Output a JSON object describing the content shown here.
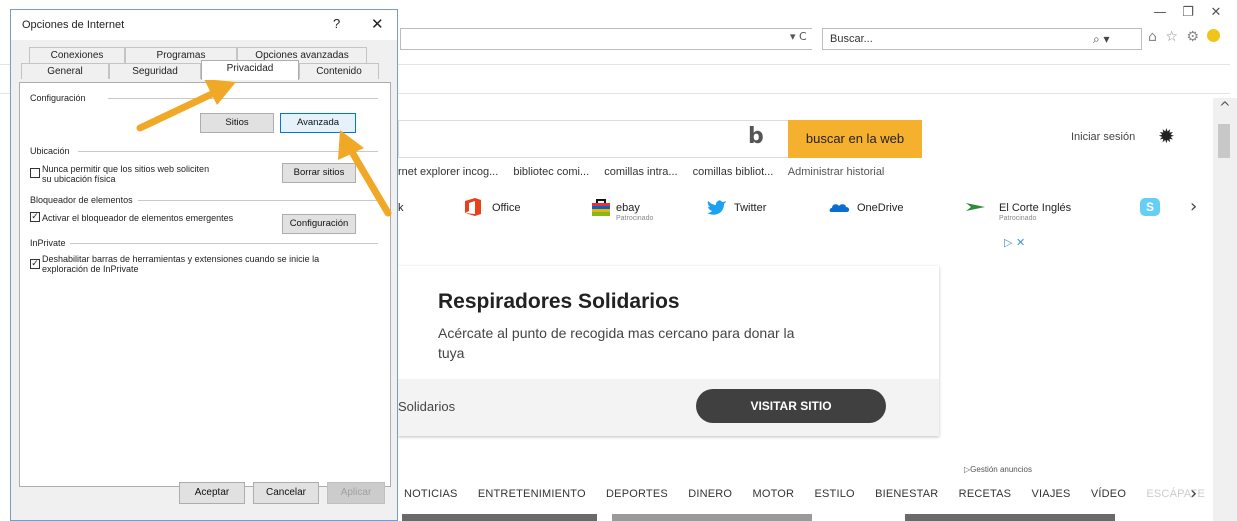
{
  "browser": {
    "window_buttons": {
      "minimize": "—",
      "restore": "❐",
      "close": "✕"
    },
    "address_controls": "▾ C",
    "search_placeholder": "Buscar...",
    "search_icon_glyph": "⌕ ▾",
    "toolbar_icons": "⌂ ☆ ⚙"
  },
  "page": {
    "bing_button": "buscar en la web",
    "signin": "Iniciar sesión",
    "history_items": [
      "rnet explorer incog...",
      "bibliotec comi...",
      "comillas intra...",
      "comillas bibliot...",
      "Administrar historial"
    ],
    "quick_links": [
      {
        "label": "k"
      },
      {
        "label": "Office",
        "color": "#e8401c"
      },
      {
        "label": "ebay",
        "sub": "Patrocinado"
      },
      {
        "label": "Twitter",
        "color": "#1da1f2"
      },
      {
        "label": "OneDrive",
        "color": "#0a6ed1"
      },
      {
        "label": "El Corte Inglés",
        "sub": "Patrocinado",
        "color": "#2e8b3a"
      },
      {
        "label": "S",
        "color": "#00aff0"
      }
    ],
    "ad_markers": "▷ ✕",
    "ad": {
      "title": "Respiradores Solidarios",
      "text": "Acércate al punto de recogida mas cercano para donar la tuya",
      "sponsor": "Solidarios",
      "button": "VISITAR SITIO"
    },
    "gestion": "▷Gestión anuncios",
    "nav_items": [
      "NOTICIAS",
      "ENTRETENIMIENTO",
      "DEPORTES",
      "DINERO",
      "MOTOR",
      "ESTILO",
      "BIENESTAR",
      "RECETAS",
      "VIAJES",
      "VÍDEO"
    ],
    "nav_faded": "ESCÁPATE"
  },
  "dialog": {
    "title": "Opciones de Internet",
    "help": "?",
    "close": "✕",
    "tabs_back": [
      "Conexiones",
      "Programas",
      "Opciones avanzadas"
    ],
    "tabs_front": [
      "General",
      "Seguridad",
      "Privacidad",
      "Contenido"
    ],
    "active_tab": "Privacidad",
    "configuracion": {
      "label": "Configuración",
      "sitios_button": "Sitios",
      "avanzada_button": "Avanzada"
    },
    "ubicacion": {
      "label": "Ubicación",
      "checkbox_line1": "Nunca permitir que los sitios web soliciten",
      "checkbox_line2": "su ubicación física",
      "checked": false,
      "button": "Borrar sitios"
    },
    "bloqueador": {
      "label": "Bloqueador de elementos",
      "checkbox": "Activar el bloqueador de elementos emergentes",
      "checked": true,
      "button": "Configuración"
    },
    "inprivate": {
      "label": "InPrivate",
      "checkbox_line1": "Deshabilitar barras de herramientas y extensiones cuando se inicie la",
      "checkbox_line2": "exploración de InPrivate",
      "checked": true
    },
    "footer": {
      "ok": "Aceptar",
      "cancel": "Cancelar",
      "apply": "Aplicar"
    }
  },
  "annotation": {
    "arrow_color": "#f0a826"
  }
}
